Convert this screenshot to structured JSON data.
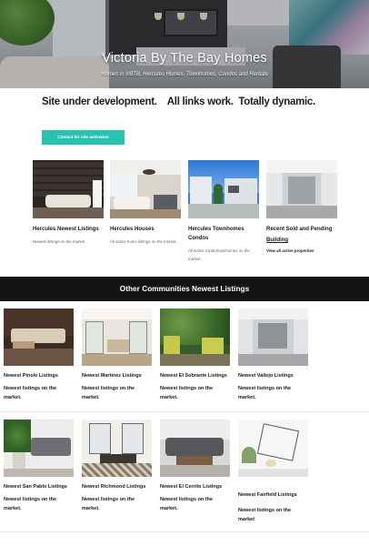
{
  "hero": {
    "title": "Victoria By The Bay Homes",
    "subtitle": "Homes in VBTB, Hercules Homes, Townhomes, Condos and Rentals"
  },
  "notice": {
    "text": "Site under development.    All links work.  Totally dynamic.",
    "cta_label": "Contact for site activation",
    "accent": "#27c3b0"
  },
  "hercules_cards": [
    {
      "title": "Hercules Newest Listings",
      "desc": "Newest listings on the market."
    },
    {
      "title": "Hercules Houses",
      "desc": "All active home listings on the market."
    },
    {
      "title": "Hercules Townhomes Condos",
      "desc": "All active condo/townhomes on the market."
    },
    {
      "title": "Recent Sold and Pending",
      "link": "Building",
      "sublink": "View all active properties"
    }
  ],
  "banner": {
    "title": "Other Communities Newest Listings",
    "background": "#141414"
  },
  "community_cards_row1": [
    {
      "title": "Newest Pinole Listings",
      "desc": "Newest listings on the market."
    },
    {
      "title": "Newest Martinez Listings",
      "desc": "Newest listings on the market."
    },
    {
      "title": "Newest El Sobrante Listings",
      "desc": "Newest listings on the market."
    },
    {
      "title": "Newest Vallejo Listings",
      "desc": " Newest listings on the market."
    }
  ],
  "community_cards_row2": [
    {
      "title": "Newest San Pablo Listings",
      "desc": "Newest listings on the market."
    },
    {
      "title": "Newest Richmond Listings",
      "desc": "Newest listings on the market."
    },
    {
      "title": "Newest El Cerrito Listings",
      "desc": "Newest listings on the market."
    },
    {
      "title": "Newest Fairfield Listings",
      "desc": "Newest listings on the market"
    }
  ]
}
